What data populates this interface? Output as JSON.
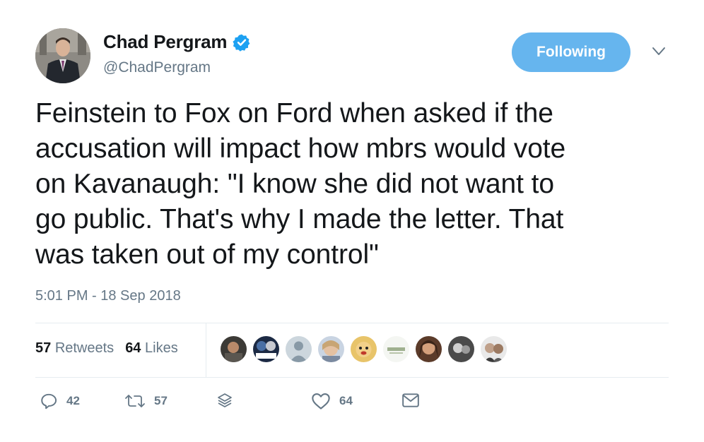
{
  "author": {
    "name": "Chad Pergram",
    "handle": "@ChadPergram",
    "verified": true
  },
  "follow_button": {
    "label": "Following"
  },
  "tweet": {
    "text": "Feinstein to Fox on Ford when asked if the\naccusation will impact how mbrs would vote\non Kavanaugh: \"I know she did not want to\ngo public. That's why I made the letter. That\nwas taken out of my control\"",
    "timestamp": "5:01 PM - 18 Sep 2018"
  },
  "stats": {
    "retweets_count": "57",
    "retweets_label": "Retweets",
    "likes_count": "64",
    "likes_label": "Likes"
  },
  "actions": {
    "reply_count": "42",
    "retweet_count": "57",
    "like_count": "64"
  },
  "icons": [
    "verified-badge-icon",
    "chevron-down-icon",
    "reply-icon",
    "retweet-icon",
    "stack-icon",
    "heart-icon",
    "direct-message-icon"
  ],
  "colors": {
    "accent": "#1da1f2",
    "button": "#66b5ee",
    "text": "#14171a",
    "muted": "#657786",
    "divider": "#e6ecf0"
  }
}
